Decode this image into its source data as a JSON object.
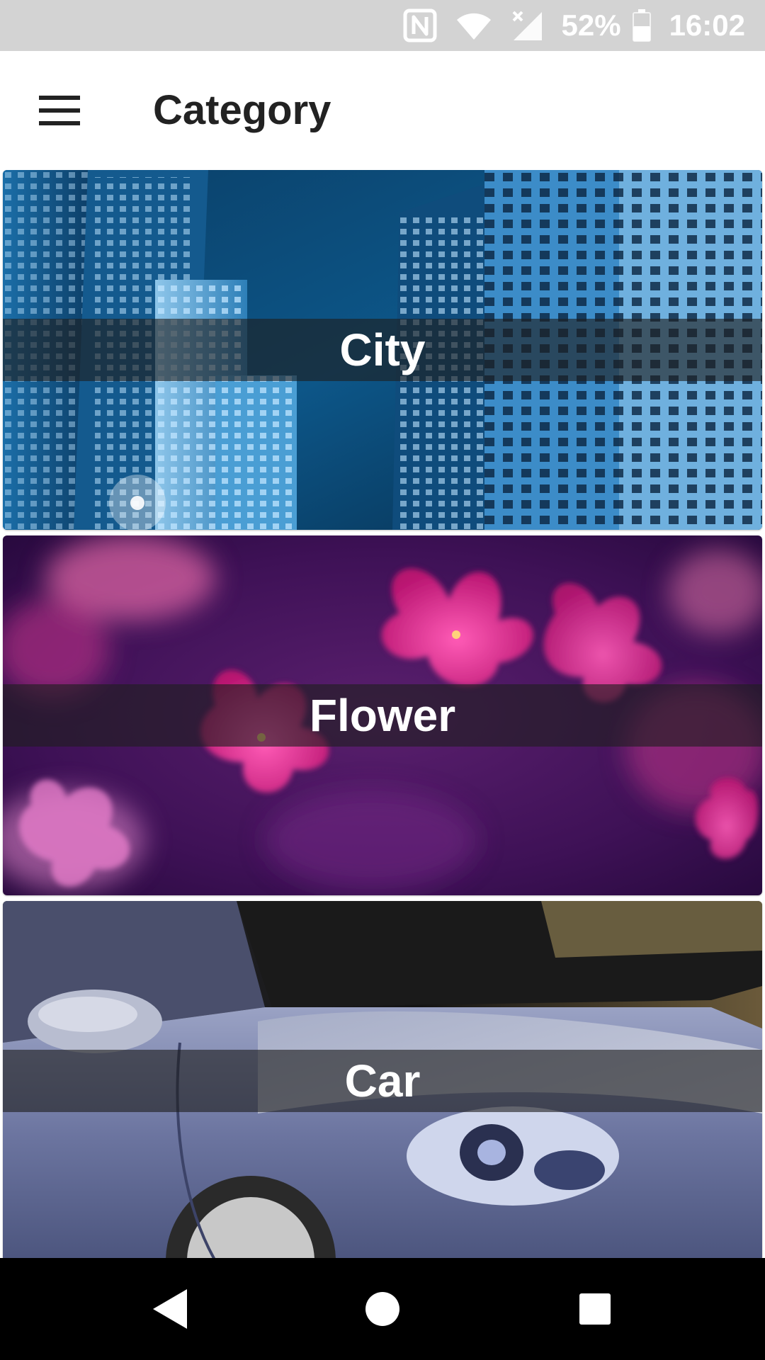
{
  "status_bar": {
    "battery": "52%",
    "time": "16:02",
    "icons": [
      "nfc-icon",
      "wifi-icon",
      "no-signal-icon",
      "battery-icon"
    ]
  },
  "app_bar": {
    "title": "Category",
    "menu_icon": "hamburger-menu-icon"
  },
  "categories": [
    {
      "label": "City"
    },
    {
      "label": "Flower"
    },
    {
      "label": "Car"
    }
  ],
  "nav_bar": {
    "icons": [
      "back-icon",
      "home-icon",
      "recents-icon"
    ]
  },
  "colors": {
    "status_bar_bg": "#d3d3d3",
    "app_bar_bg": "#ffffff",
    "title_text": "#222222",
    "label_band": "#1e1e1e",
    "nav_bar_bg": "#000000"
  }
}
